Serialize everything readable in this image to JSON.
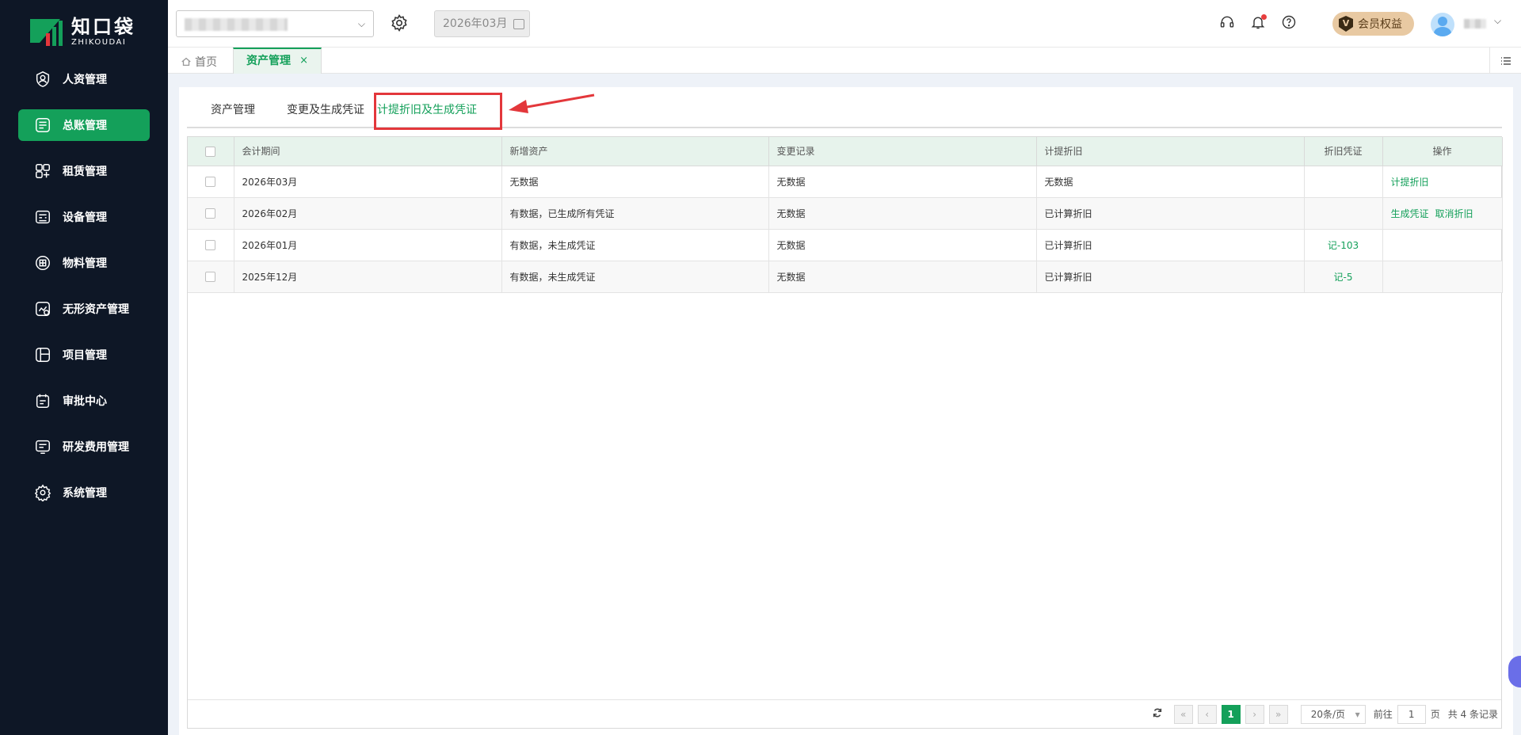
{
  "app": {
    "logo_cn": "知口袋",
    "logo_en": "ZHIKOUDAI"
  },
  "sidebar": {
    "items": [
      {
        "label": "人资管理",
        "icon": "person-icon",
        "active": false
      },
      {
        "label": "总账管理",
        "icon": "ledger-icon",
        "active": true
      },
      {
        "label": "租赁管理",
        "icon": "lease-icon",
        "active": false
      },
      {
        "label": "设备管理",
        "icon": "equipment-icon",
        "active": false
      },
      {
        "label": "物料管理",
        "icon": "material-icon",
        "active": false
      },
      {
        "label": "无形资产管理",
        "icon": "intangible-asset-icon",
        "active": false
      },
      {
        "label": "项目管理",
        "icon": "project-icon",
        "active": false
      },
      {
        "label": "审批中心",
        "icon": "approval-icon",
        "active": false
      },
      {
        "label": "研发费用管理",
        "icon": "rnd-expense-icon",
        "active": false
      },
      {
        "label": "系统管理",
        "icon": "gear-icon",
        "active": false
      }
    ]
  },
  "header": {
    "period": "2026年03月",
    "vip_badge": "V",
    "vip_label": "会员权益"
  },
  "tabs": {
    "home": "首页",
    "active": "资产管理",
    "close": "×"
  },
  "subtabs": [
    "资产管理",
    "变更及生成凭证",
    "计提折旧及生成凭证"
  ],
  "table": {
    "columns": [
      "会计期间",
      "新增资产",
      "变更记录",
      "计提折旧",
      "折旧凭证",
      "操作"
    ],
    "rows": [
      {
        "period": "2026年03月",
        "new_assets": "无数据",
        "changes": "无数据",
        "depreciation": "无数据",
        "voucher": "",
        "actions": [
          "计提折旧"
        ]
      },
      {
        "period": "2026年02月",
        "new_assets": "有数据，已生成所有凭证",
        "changes": "无数据",
        "depreciation": "已计算折旧",
        "voucher": "",
        "actions": [
          "生成凭证",
          "取消折旧"
        ]
      },
      {
        "period": "2026年01月",
        "new_assets": "有数据，未生成凭证",
        "changes": "无数据",
        "depreciation": "已计算折旧",
        "voucher": "记-103",
        "actions": []
      },
      {
        "period": "2025年12月",
        "new_assets": "有数据，未生成凭证",
        "changes": "无数据",
        "depreciation": "已计算折旧",
        "voucher": "记-5",
        "actions": []
      }
    ]
  },
  "pagination": {
    "first": "«",
    "prev": "‹",
    "current": "1",
    "next": "›",
    "last": "»",
    "page_size": "20条/页",
    "goto_label": "前往",
    "goto_value": "1",
    "page_unit": "页",
    "total": "共 4 条记录"
  },
  "colors": {
    "primary": "#14a05a",
    "sidebar_bg": "#0e1726",
    "highlight": "#e3373b"
  }
}
